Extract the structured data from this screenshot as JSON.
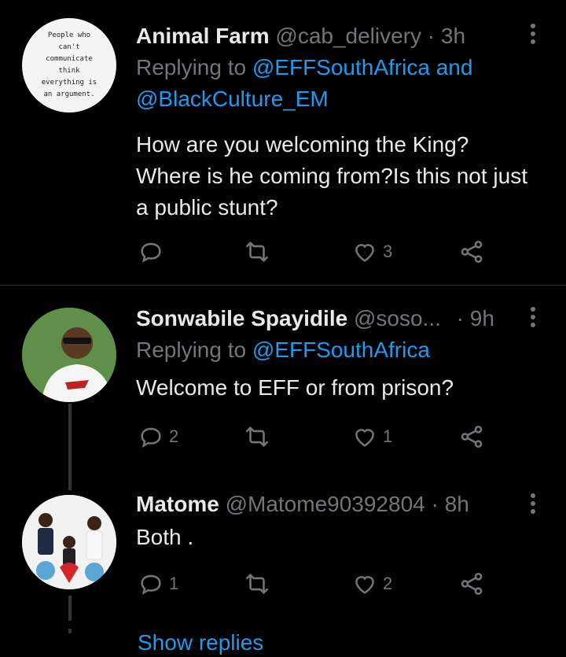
{
  "tweets": [
    {
      "author": "Animal Farm",
      "handle": "@cab_delivery",
      "separator": "·",
      "time": "3h",
      "replying_prefix": "Replying to",
      "replying_to_1": "@EFFSouthAfrica",
      "replying_and": "and",
      "replying_to_2": "@BlackCulture_EM",
      "text": "How are you welcoming the King? Where is he coming from?Is this not just a public stunt?",
      "avatar_text": "People who can't communicate think everything is an argument.",
      "replies": "",
      "retweets": "",
      "likes": "3"
    },
    {
      "author": "Sonwabile Spayidile",
      "handle": "@soso...",
      "separator": "·",
      "time": "9h",
      "replying_prefix": "Replying to",
      "replying_to_1": "@EFFSouthAfrica",
      "text": "Welcome to EFF or from prison?",
      "replies": "2",
      "retweets": "",
      "likes": "1"
    },
    {
      "author": "Matome",
      "handle": "@Matome90392804",
      "separator": "·",
      "time": "8h",
      "text": "Both .",
      "replies": "1",
      "retweets": "",
      "likes": "2"
    }
  ],
  "footer_partial_link": "Show replies",
  "icons": [
    "reply-icon",
    "retweet-icon",
    "like-icon",
    "share-icon",
    "more-icon"
  ],
  "colors": {
    "background": "#000000",
    "text": "#e7e9ea",
    "muted": "#71767b",
    "link": "#1d9bf0"
  }
}
